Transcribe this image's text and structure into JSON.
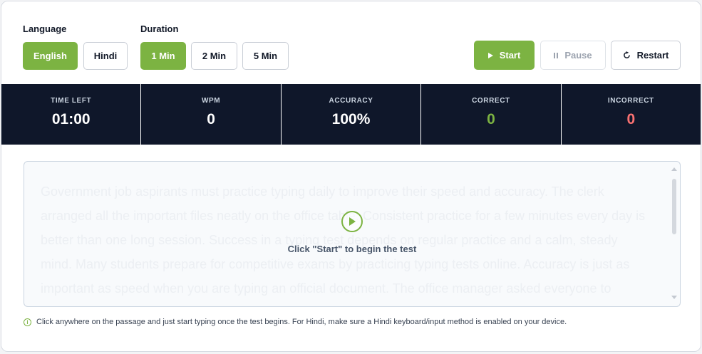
{
  "language": {
    "label": "Language",
    "options": [
      "English",
      "Hindi"
    ],
    "selected": "English"
  },
  "duration": {
    "label": "Duration",
    "options": [
      "1 Min",
      "2 Min",
      "5 Min"
    ],
    "selected": "1 Min"
  },
  "controls": {
    "start": "Start",
    "pause": "Pause",
    "restart": "Restart"
  },
  "stats": [
    {
      "label": "TIME LEFT",
      "value": "01:00"
    },
    {
      "label": "WPM",
      "value": "0"
    },
    {
      "label": "ACCURACY",
      "value": "100%"
    },
    {
      "label": "CORRECT",
      "value": "0"
    },
    {
      "label": "INCORRECT",
      "value": "0"
    }
  ],
  "passage": {
    "text": "Government job aspirants must practice typing daily to improve their speed and accuracy. The clerk arranged all the important files neatly on the office table. Consistent practice for a few minutes every day is better than one long session. Success in a typing test depends on regular practice and a calm, steady mind. Many students prepare for competitive exams by practicing typing tests online. Accuracy is just as important as speed when you are typing an official document. The office manager asked everyone to submit their reports before the meeting. Time",
    "overlay_message": "Click \"Start\" to begin the test"
  },
  "hint": "Click anywhere on the passage and just start typing once the test begins. For Hindi, make sure a Hindi keyboard/input method is enabled on your device.",
  "colors": {
    "accent": "#7cb342",
    "stats_bg": "#0f172a",
    "correct": "#7cb342",
    "incorrect": "#f87171"
  },
  "icons": {
    "start": "play-icon",
    "pause": "pause-icon",
    "restart": "restart-icon",
    "overlay": "play-circle-icon",
    "hint": "info-icon"
  }
}
